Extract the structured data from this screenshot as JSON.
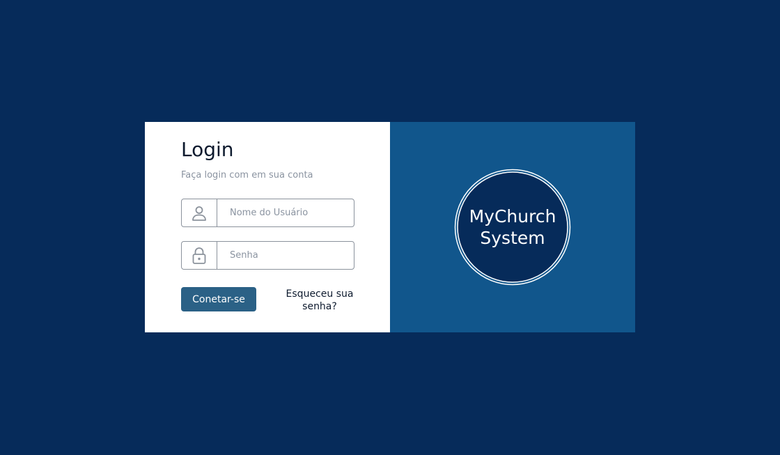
{
  "login": {
    "title": "Login",
    "subtitle": "Faça login com em sua conta",
    "username": {
      "placeholder": "Nome do Usuário",
      "value": "",
      "icon": "user-icon"
    },
    "password": {
      "placeholder": "Senha",
      "value": "",
      "icon": "lock-icon"
    },
    "submit_label": "Conetar-se",
    "forgot_line1": "Esqueceu sua",
    "forgot_line2": "senha?"
  },
  "brand": {
    "line1": "MyChurch",
    "line2": "System"
  },
  "colors": {
    "background": "#062b5a",
    "brand_panel": "#11568c",
    "button": "#2b6186",
    "logo_circle": "#062b5a"
  }
}
